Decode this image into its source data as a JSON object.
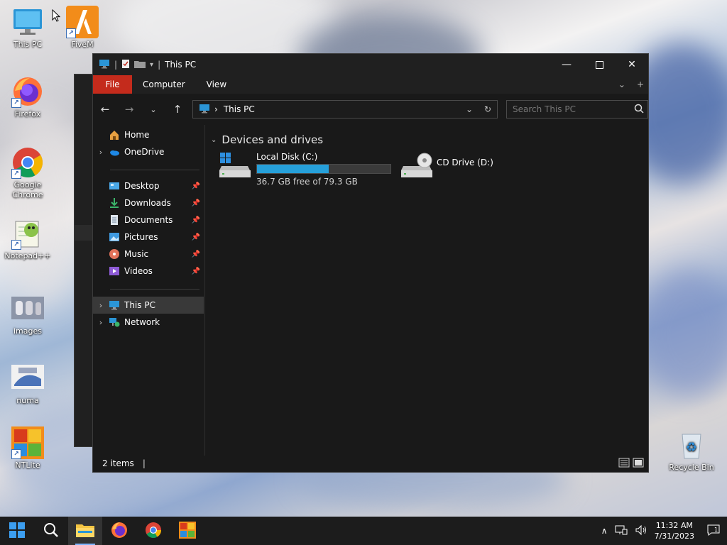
{
  "desktop": {
    "icons": [
      {
        "label": "This PC"
      },
      {
        "label": "FiveM"
      },
      {
        "label": "Firefox"
      },
      {
        "label": "Google Chrome"
      },
      {
        "label": "Notepad++"
      },
      {
        "label": "images"
      },
      {
        "label": "numa"
      },
      {
        "label": "NTLite"
      },
      {
        "label": "Recycle Bin"
      }
    ]
  },
  "explorer": {
    "title": "This PC",
    "ribbon": {
      "file": "File",
      "computer": "Computer",
      "view": "View"
    },
    "address": {
      "crumb_sep": "›",
      "location": "This PC"
    },
    "search": {
      "placeholder": "Search This PC"
    },
    "nav": {
      "home": "Home",
      "onedrive": "OneDrive",
      "desktop": "Desktop",
      "downloads": "Downloads",
      "documents": "Documents",
      "pictures": "Pictures",
      "music": "Music",
      "videos": "Videos",
      "thispc": "This PC",
      "network": "Network"
    },
    "group": "Devices and drives",
    "drives": [
      {
        "name": "Local Disk (C:)",
        "free_text": "36.7 GB free of 79.3 GB",
        "used_fraction": 0.537
      },
      {
        "name": "CD Drive (D:)"
      }
    ],
    "status": {
      "items": "2 items",
      "sep": "|"
    }
  },
  "taskbar": {
    "time": "11:32 AM",
    "date": "7/31/2023",
    "accent": "#0078d4"
  }
}
